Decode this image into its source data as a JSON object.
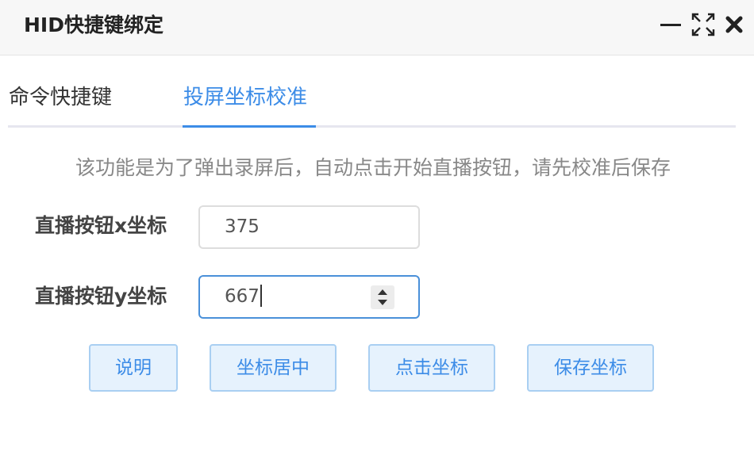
{
  "window": {
    "title": "HID快捷键绑定",
    "minimize_icon": "minimize-icon",
    "maximize_icon": "maximize-icon",
    "close_icon": "close-icon"
  },
  "tabs": [
    {
      "label": "命令快捷键",
      "active": false
    },
    {
      "label": "投屏坐标校准",
      "active": true
    }
  ],
  "description": "该功能是为了弹出录屏后，自动点击开始直播按钮，请先校准后保存",
  "fields": {
    "x": {
      "label": "直播按钮x坐标",
      "value": "375"
    },
    "y": {
      "label": "直播按钮y坐标",
      "value": "667"
    }
  },
  "buttons": {
    "help": "说明",
    "center": "坐标居中",
    "click": "点击坐标",
    "save": "保存坐标"
  },
  "colors": {
    "accent": "#3c8ce7",
    "button_bg": "#e6f2fd",
    "button_border": "#a9cff2"
  }
}
